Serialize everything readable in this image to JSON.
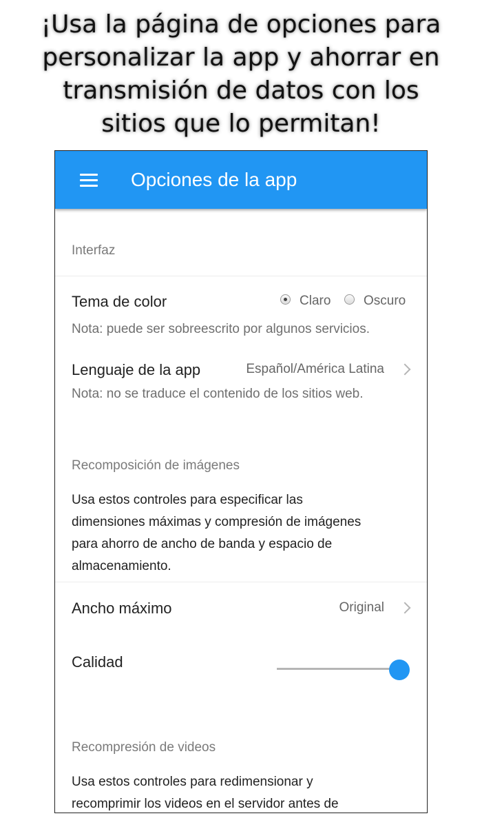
{
  "promo": {
    "line1": "¡Usa la página de opciones para",
    "line2": "personalizar la app y ahorrar en",
    "line3": "transmisión de datos con los",
    "line4": "sitios que lo permitan!"
  },
  "app": {
    "title": "Opciones de la app",
    "accent_color": "#2196F3"
  },
  "interface": {
    "header": "Interfaz",
    "theme": {
      "label": "Tema de color",
      "options": [
        {
          "label": "Claro",
          "selected": true
        },
        {
          "label": "Oscuro",
          "selected": false
        }
      ],
      "note": "Nota: puede ser sobreescrito por algunos servicios."
    },
    "language": {
      "label": "Lenguaje de la app",
      "value": "Español/América Latina",
      "note": "Nota: no se traduce el contenido de los sitios web."
    }
  },
  "images": {
    "header": "Recomposición de imágenes",
    "description_lines": [
      "Usa estos controles para especificar las",
      "dimensiones máximas y compresión de imágenes",
      "para ahorro de ancho de banda y espacio de",
      "almacenamiento."
    ],
    "max_width": {
      "label": "Ancho máximo",
      "value": "Original"
    },
    "quality": {
      "label": "Calidad",
      "level": 1.0
    }
  },
  "videos": {
    "header": "Recompresión de videos",
    "description_lines": [
      "Usa estos controles para redimensionar y",
      "recomprimir los videos en el servidor antes de"
    ]
  }
}
